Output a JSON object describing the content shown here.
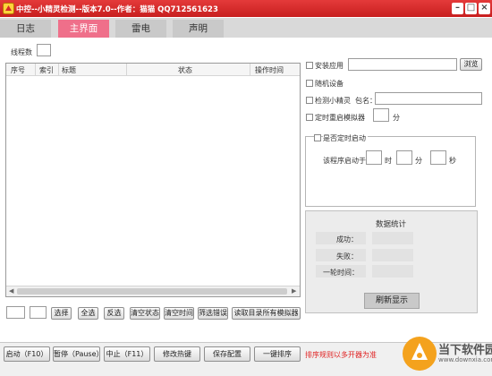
{
  "window": {
    "title": "中控--小精灵检测--版本7.0--作者：猫猫 QQ712561623"
  },
  "tabs": [
    "日志",
    "主界面",
    "雷电",
    "声明"
  ],
  "active_tab": "主界面",
  "thread": {
    "label": "线程数",
    "value": ""
  },
  "table": {
    "columns": [
      "序号",
      "索引",
      "标题",
      "状态",
      "操作时间"
    ],
    "rows": []
  },
  "list_buttons": {
    "field1": "",
    "field2": "",
    "select": "选择",
    "select_all": "全选",
    "invert": "反选",
    "clear_status": "清空状态",
    "clear_time": "清空时间",
    "filter_errors": "筛选错误",
    "read_all_emulators": "读取目录所有模拟器"
  },
  "options": {
    "install_app": {
      "label": "安装应用",
      "value": "",
      "browse": "浏览"
    },
    "random_device": {
      "label": "随机设备"
    },
    "detect_sprite": {
      "label": "检测小精灵",
      "package_label": "包名：",
      "package_value": ""
    },
    "timed_restart": {
      "label": "定时重启模拟器",
      "value": "",
      "unit": "分"
    }
  },
  "timed_start": {
    "label": "是否定时启动",
    "prefix": "该程序启动于",
    "hour_value": "",
    "hour_unit": "时",
    "min_value": "",
    "min_unit": "分",
    "sec_value": "",
    "sec_unit": "秒"
  },
  "stats": {
    "title": "数据统计",
    "success_label": "成功：",
    "success_value": "",
    "fail_label": "失败：",
    "fail_value": "",
    "round_time_label": "一轮时间：",
    "round_time_value": "",
    "refresh": "刷新显示"
  },
  "bottom": {
    "start": "启动（F10）",
    "pause": "暂停（Pause）",
    "stop": "中止（F11）",
    "edit_hotkeys": "修改热键",
    "save_config": "保存配置",
    "sort": "一键排序",
    "notice": "排序规则以多开器为准"
  },
  "watermark": {
    "text": "当下软件园",
    "sub": "www.downxia.com"
  },
  "colors": {
    "titlebar": "#d42a2a",
    "active_tab": "#ef6f8a",
    "notice": "#e02020"
  }
}
